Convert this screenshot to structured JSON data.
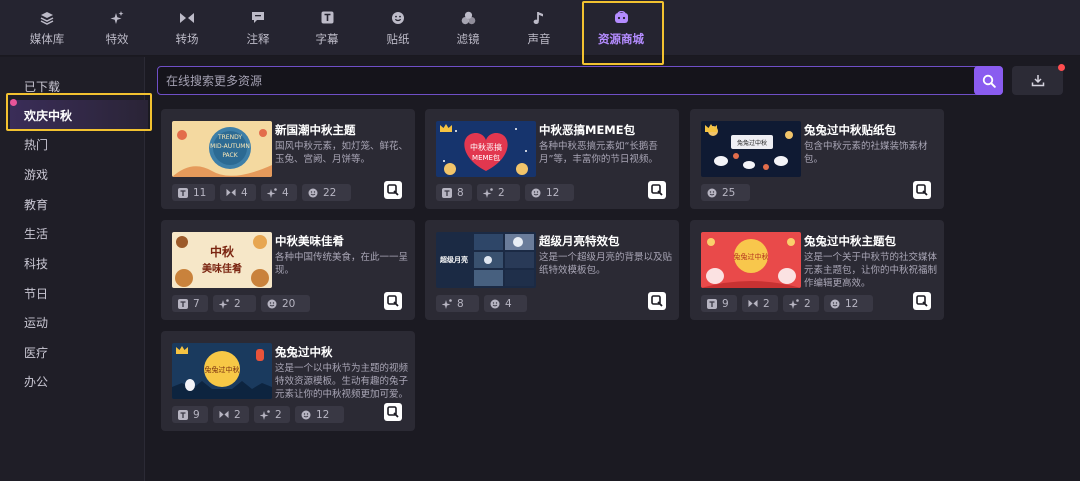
{
  "tabs": [
    {
      "label": "媒体库",
      "icon": "layers-icon"
    },
    {
      "label": "特效",
      "icon": "sparkle-icon"
    },
    {
      "label": "转场",
      "icon": "transition-icon"
    },
    {
      "label": "注释",
      "icon": "comment-icon"
    },
    {
      "label": "字幕",
      "icon": "text-icon"
    },
    {
      "label": "贴纸",
      "icon": "smiley-icon"
    },
    {
      "label": "滤镜",
      "icon": "filter-icon"
    },
    {
      "label": "声音",
      "icon": "music-icon"
    },
    {
      "label": "资源商城",
      "icon": "store-icon",
      "active": true
    }
  ],
  "sidebar": {
    "items": [
      "已下载",
      "欢庆中秋",
      "热门",
      "游戏",
      "教育",
      "生活",
      "科技",
      "节日",
      "运动",
      "医疗",
      "办公"
    ],
    "active_index": 1
  },
  "search": {
    "placeholder": "在线搜索更多资源"
  },
  "colors": {
    "accent": "#8a5cf0",
    "highlight": "#f2c230",
    "card_bg": "#2b2a34",
    "app_bg": "#1b1a22"
  },
  "cards": [
    {
      "title": "新国潮中秋主题",
      "desc": "国风中秋元素，如灯笼、鲜花、玉兔、宫阙、月饼等。",
      "crown": false,
      "thumb_text": [
        "TRENDY",
        "MID-AUTUMN",
        "PACK"
      ],
      "badges": [
        {
          "icon": "text-icon",
          "count": "11"
        },
        {
          "icon": "transition-icon",
          "count": "4"
        },
        {
          "icon": "sparkle-icon",
          "count": "4"
        },
        {
          "icon": "smiley-icon",
          "count": "22"
        }
      ]
    },
    {
      "title": "中秋恶搞MEME包",
      "desc": "各种中秋恶搞元素如“长鹅吾月”等，丰富你的节日视频。",
      "crown": true,
      "thumb_text": [
        "中秋恶搞",
        "MEME包"
      ],
      "badges": [
        {
          "icon": "text-icon",
          "count": "8"
        },
        {
          "icon": "sparkle-icon",
          "count": "2"
        },
        {
          "icon": "smiley-icon",
          "count": "12"
        }
      ]
    },
    {
      "title": "兔兔过中秋贴纸包",
      "desc": "包含中秋元素的社媒装饰素材包。",
      "crown": true,
      "thumb_text": [
        "兔兔过中秋"
      ],
      "badges": [
        {
          "icon": "smiley-icon",
          "count": "25"
        }
      ]
    },
    {
      "title": "中秋美味佳肴",
      "desc": "各种中国传统美食，在此一一呈现。",
      "crown": false,
      "thumb_text": [
        "中秋",
        "美味佳肴"
      ],
      "badges": [
        {
          "icon": "text-icon",
          "count": "7"
        },
        {
          "icon": "sparkle-icon",
          "count": "2"
        },
        {
          "icon": "smiley-icon",
          "count": "20"
        }
      ]
    },
    {
      "title": "超级月亮特效包",
      "desc": "这是一个超级月亮的背景以及贴纸特效模板包。",
      "crown": false,
      "thumb_text": [
        "超级月亮"
      ],
      "badges": [
        {
          "icon": "sparkle-icon",
          "count": "8"
        },
        {
          "icon": "smiley-icon",
          "count": "4"
        }
      ]
    },
    {
      "title": "兔兔过中秋主题包",
      "desc": "这是一个关于中秋节的社交媒体元素主题包，让你的中秋祝福制作编辑更高效。",
      "crown": false,
      "thumb_text": [
        "兔兔过中秋"
      ],
      "badges": [
        {
          "icon": "text-icon",
          "count": "9"
        },
        {
          "icon": "transition-icon",
          "count": "2"
        },
        {
          "icon": "sparkle-icon",
          "count": "2"
        },
        {
          "icon": "smiley-icon",
          "count": "12"
        }
      ]
    },
    {
      "title": "兔兔过中秋",
      "desc": "这是一个以中秋节为主题的视频特效资源模板。生动有趣的兔子元素让你的中秋视频更加可爱。",
      "crown": true,
      "thumb_text": [
        "兔兔过中秋"
      ],
      "badges": [
        {
          "icon": "text-icon",
          "count": "9"
        },
        {
          "icon": "transition-icon",
          "count": "2"
        },
        {
          "icon": "sparkle-icon",
          "count": "2"
        },
        {
          "icon": "smiley-icon",
          "count": "12"
        }
      ]
    }
  ]
}
